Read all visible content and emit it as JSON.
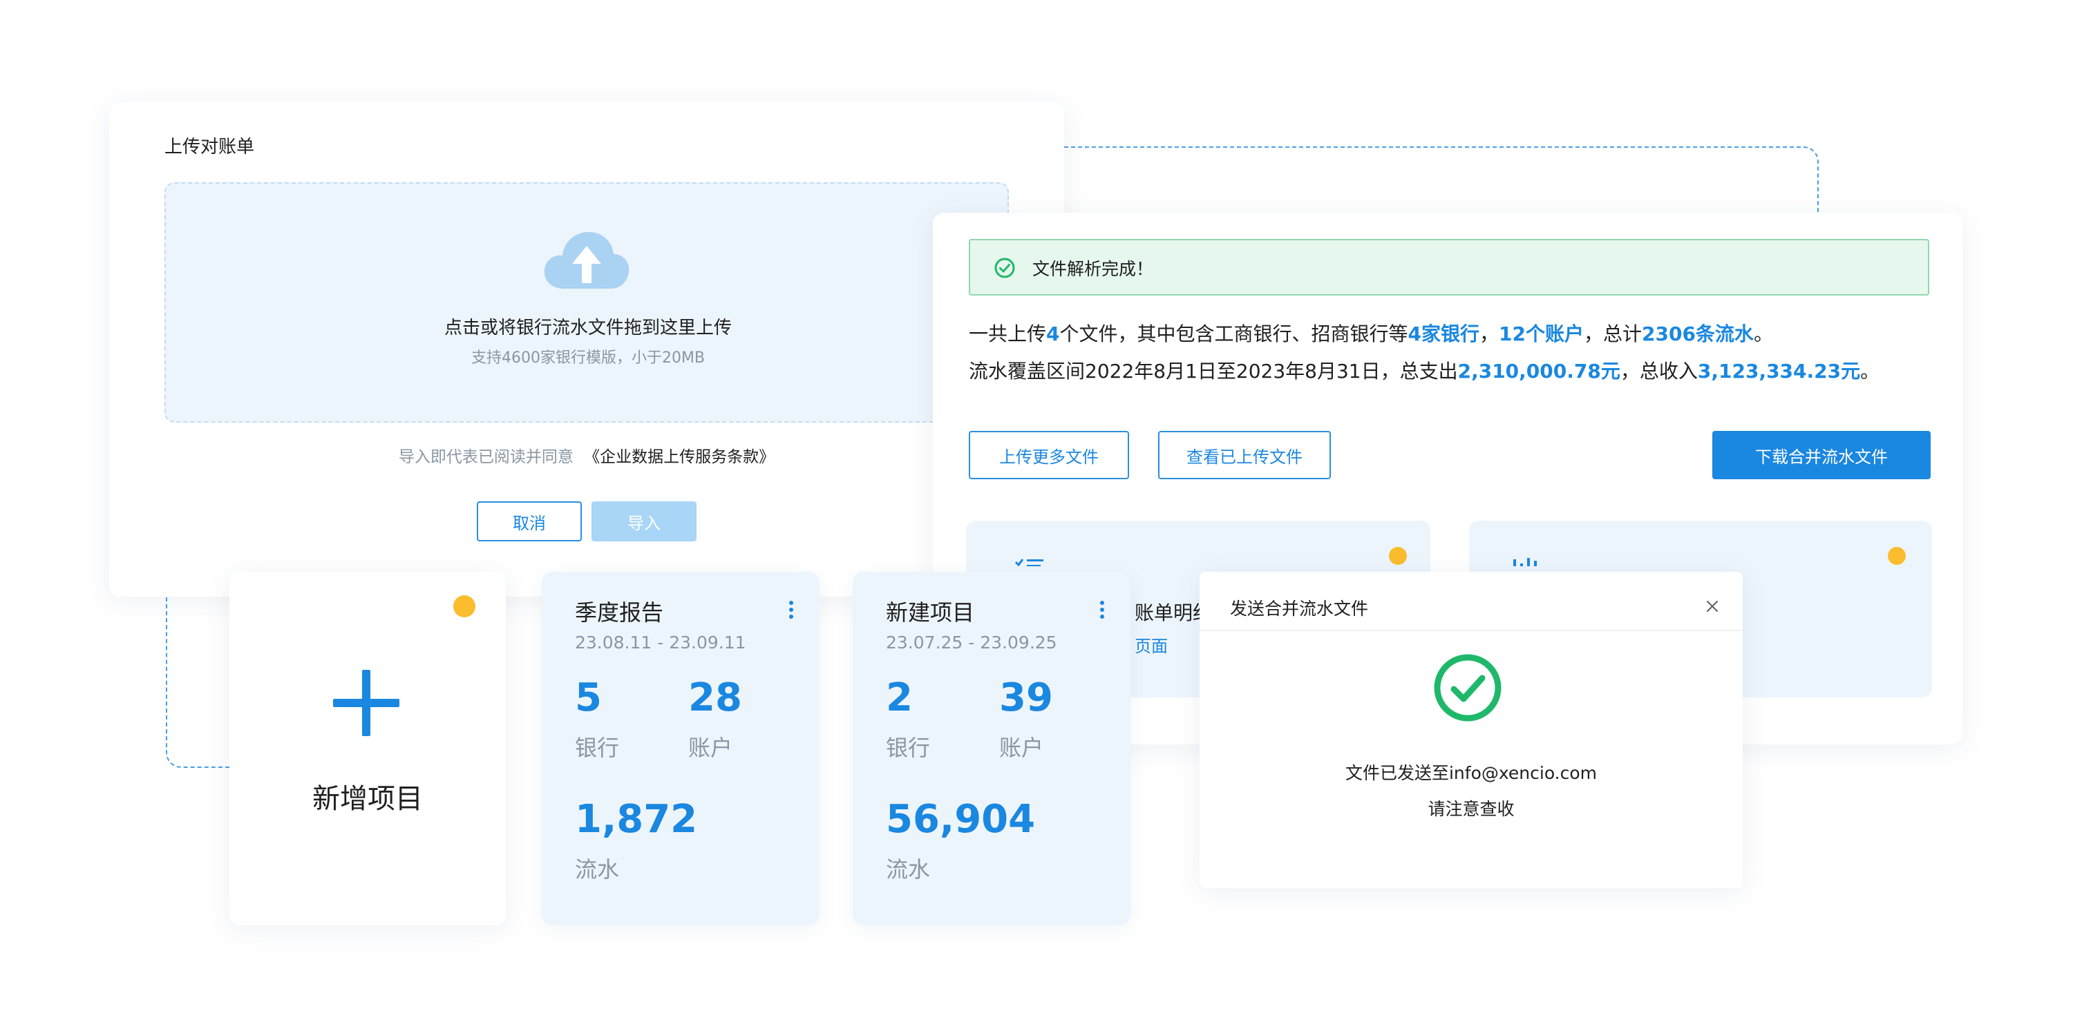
{
  "upload": {
    "title": "上传对账单",
    "drop_main": "点击或将银行流水文件拖到这里上传",
    "drop_sub": "支持4600家银行模版，小于20MB",
    "agree_prefix": "导入即代表已阅读并同意",
    "agree_link": "《企业数据上传服务条款》",
    "cancel_label": "取消",
    "import_label": "导入"
  },
  "result": {
    "success_msg": "文件解析完成！",
    "line1": {
      "p1": "一共上传",
      "files": "4",
      "p2": "个文件，其中包含工商银行、招商银行等",
      "banks": "4家银行",
      "p3": "，",
      "accounts": "12个账户",
      "p4": "，总计",
      "flows": "2306条流水",
      "p5": "。"
    },
    "line2": {
      "p1": "流水覆盖区间2022年8月1日至2023年8月31日，总支出",
      "expense": "2,310,000.78元",
      "p2": "，总收入",
      "income": "3,123,334.23元",
      "p3": "。"
    },
    "upload_more_label": "上传更多文件",
    "view_uploaded_label": "查看已上传文件",
    "download_label": "下载合并流水文件",
    "feature1_text": "账单明细",
    "feature1_link": "页面"
  },
  "new_project": {
    "label": "新增项目"
  },
  "projects": [
    {
      "title": "季度报告",
      "date": "23.08.11 - 23.09.11",
      "banks": "5",
      "banks_label": "银行",
      "accounts": "28",
      "accounts_label": "账户",
      "flows": "1,872",
      "flows_label": "流水"
    },
    {
      "title": "新建项目",
      "date": "23.07.25 - 23.09.25",
      "banks": "2",
      "banks_label": "银行",
      "accounts": "39",
      "accounts_label": "账户",
      "flows": "56,904",
      "flows_label": "流水"
    }
  ],
  "send_dialog": {
    "title": "发送合并流水文件",
    "message": "文件已发送至info@xencio.com",
    "note": "请注意查收"
  },
  "colors": {
    "accent": "#1a87e0",
    "success": "#1fb86a",
    "warning_dot": "#fbbd2e",
    "panel_bg": "#edf5fc"
  }
}
